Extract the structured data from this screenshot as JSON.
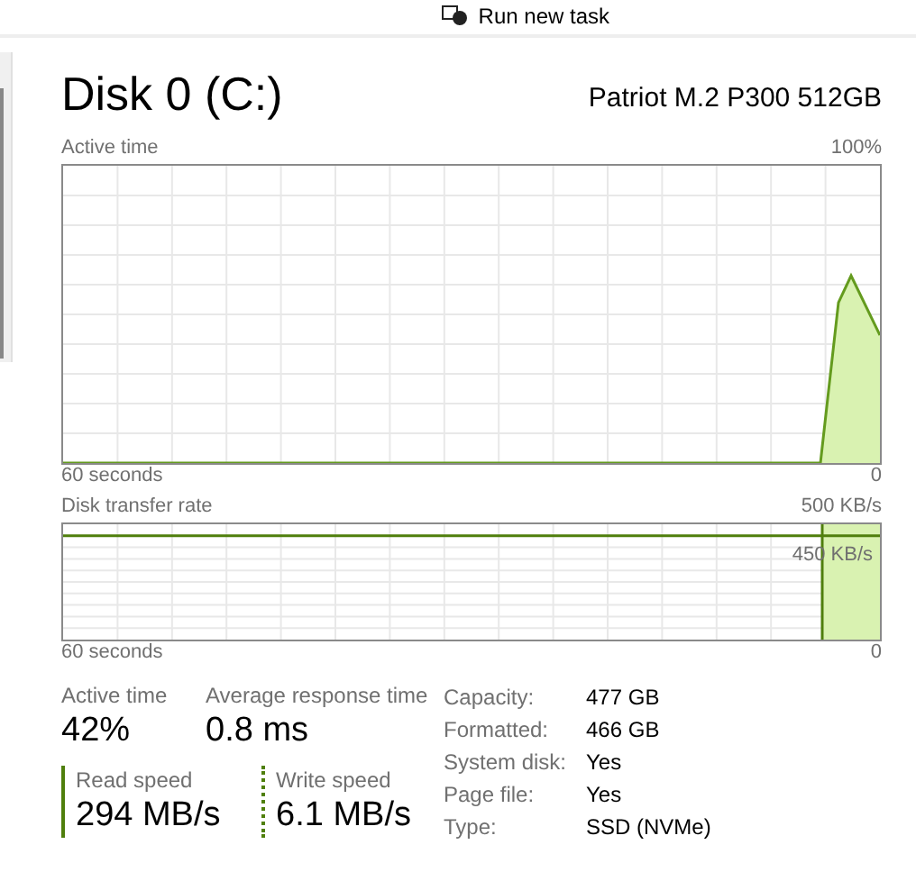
{
  "toolbar": {
    "run_task": "Run new task"
  },
  "header": {
    "title": "Disk 0 (C:)",
    "model": "Patriot M.2 P300 512GB"
  },
  "charts": [
    {
      "kind": "activity",
      "title": "Active time",
      "max_label": "100%",
      "time_label": "60 seconds",
      "zero_label": "0"
    },
    {
      "kind": "transfer",
      "title": "Disk transfer rate",
      "max_label": "500 KB/s",
      "reference_label": "450 KB/s",
      "time_label": "60 seconds",
      "zero_label": "0"
    }
  ],
  "stats": [
    {
      "label": "Active time",
      "value": "42%"
    },
    {
      "label": "Average response time",
      "value": "0.8 ms"
    }
  ],
  "speeds": [
    {
      "label": "Read speed",
      "value": "294 MB/s",
      "kind": "solid"
    },
    {
      "label": "Write speed",
      "value": "6.1 MB/s",
      "kind": "dotted"
    }
  ],
  "details": [
    {
      "label": "Capacity:",
      "value": "477 GB"
    },
    {
      "label": "Formatted:",
      "value": "466 GB"
    },
    {
      "label": "System disk:",
      "value": "Yes"
    },
    {
      "label": "Page file:",
      "value": "Yes"
    },
    {
      "label": "Type:",
      "value": "SSD (NVMe)"
    }
  ]
}
